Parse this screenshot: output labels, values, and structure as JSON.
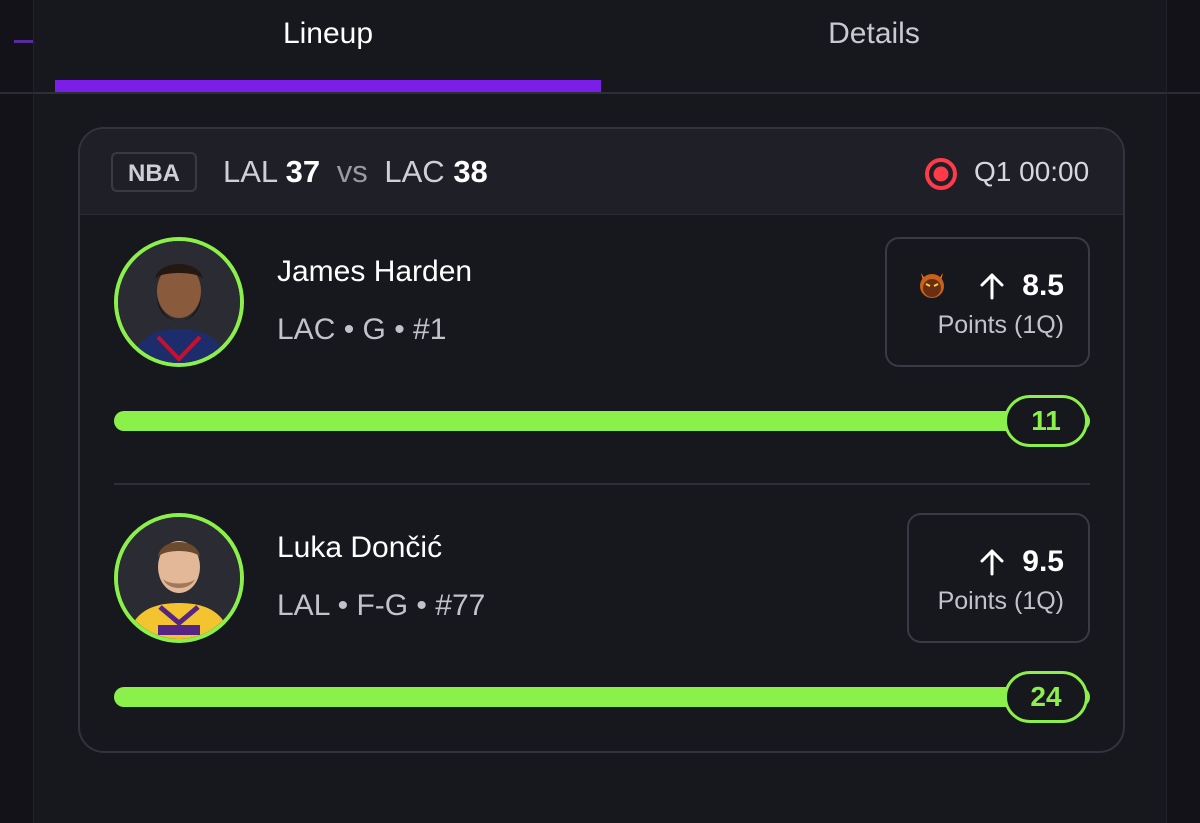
{
  "tabs": [
    {
      "label": "Lineup",
      "active": true
    },
    {
      "label": "Details",
      "active": false
    }
  ],
  "colors": {
    "accent_tab": "#7b1fe8",
    "progress": "#8cf04a",
    "live": "#ff3b4a",
    "background": "#17171e"
  },
  "game": {
    "league": "NBA",
    "away_team": "LAL",
    "away_score": "37",
    "vs": "vs",
    "home_team": "LAC",
    "home_score": "38",
    "status": "Q1 00:00",
    "live_icon": "live-record-icon"
  },
  "players": [
    {
      "name": "James Harden",
      "meta": "LAC • G • #1",
      "prop_icon": "demon-icon",
      "direction_icon": "arrow-up-icon",
      "line": "8.5",
      "stat": "Points (1Q)",
      "current": "11",
      "progress_fraction": 1.0
    },
    {
      "name": "Luka Dončić",
      "meta": "LAL • F-G • #77",
      "direction_icon": "arrow-up-icon",
      "line": "9.5",
      "stat": "Points (1Q)",
      "current": "24",
      "progress_fraction": 1.0
    }
  ]
}
